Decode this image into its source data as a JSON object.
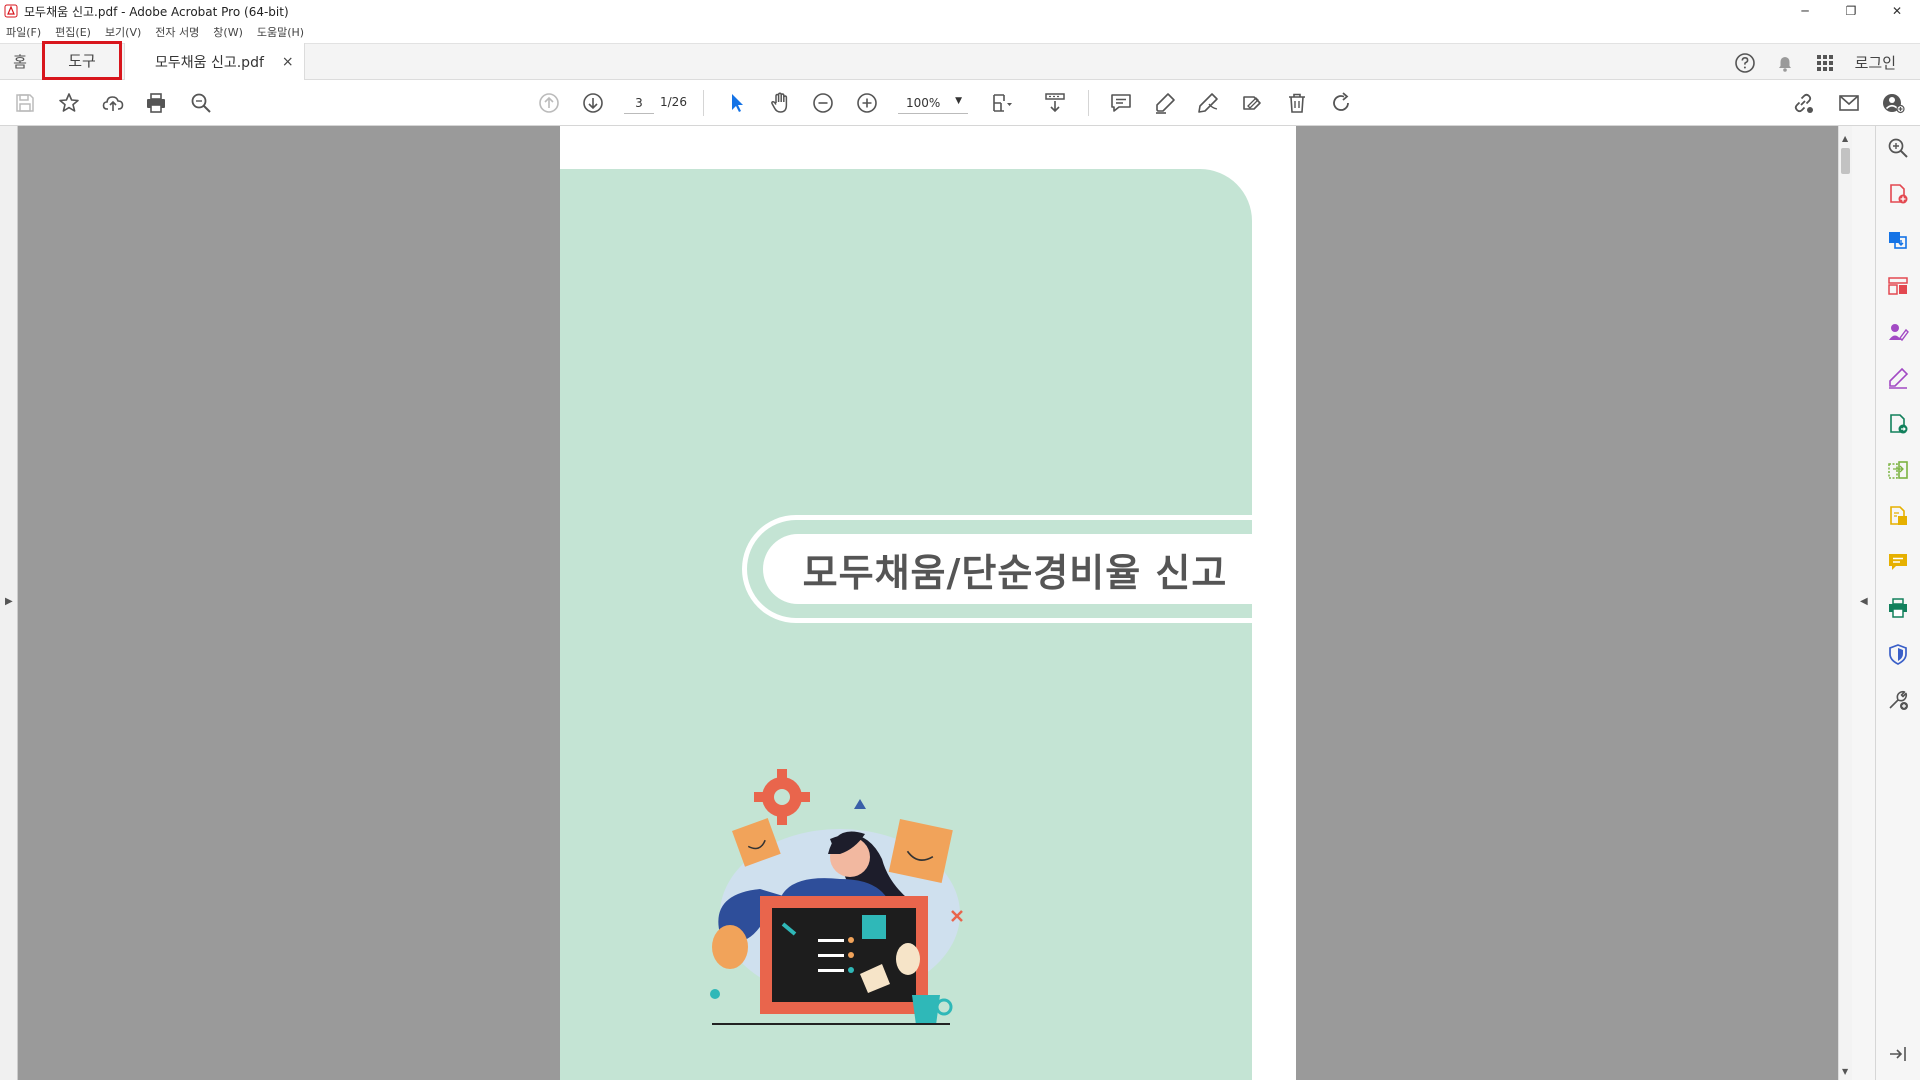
{
  "window": {
    "title": "모두채움 신고.pdf - Adobe Acrobat Pro (64-bit)",
    "controls": [
      "─",
      "❐",
      "✕"
    ]
  },
  "menu": [
    "파일(F)",
    "편집(E)",
    "보기(V)",
    "전자 서명",
    "창(W)",
    "도움말(H)"
  ],
  "tabs": {
    "home": "홈",
    "tools": "도구",
    "document": "모두채움 신고.pdf",
    "close": "×"
  },
  "header_right": {
    "login": "로그인"
  },
  "toolbar": {
    "page_current": "3",
    "page_total": "1/26",
    "zoom": "100%"
  },
  "document": {
    "heading": "모두채움/단순경비율 신고"
  },
  "colors": {
    "accent_red": "#d8151c",
    "page_green": "#c4e4d4",
    "canvas_gray": "#9a9a9a"
  },
  "right_tools_icons": [
    "zoom-icon",
    "create-pdf-icon",
    "export-pdf-icon",
    "organize-pages-icon",
    "request-signature-icon",
    "fill-sign-icon",
    "send-for-comments-icon",
    "compare-files-icon",
    "edit-pdf-icon",
    "comment-icon",
    "print-production-icon",
    "protect-icon",
    "more-tools-icon",
    "collapse-panel-icon"
  ]
}
